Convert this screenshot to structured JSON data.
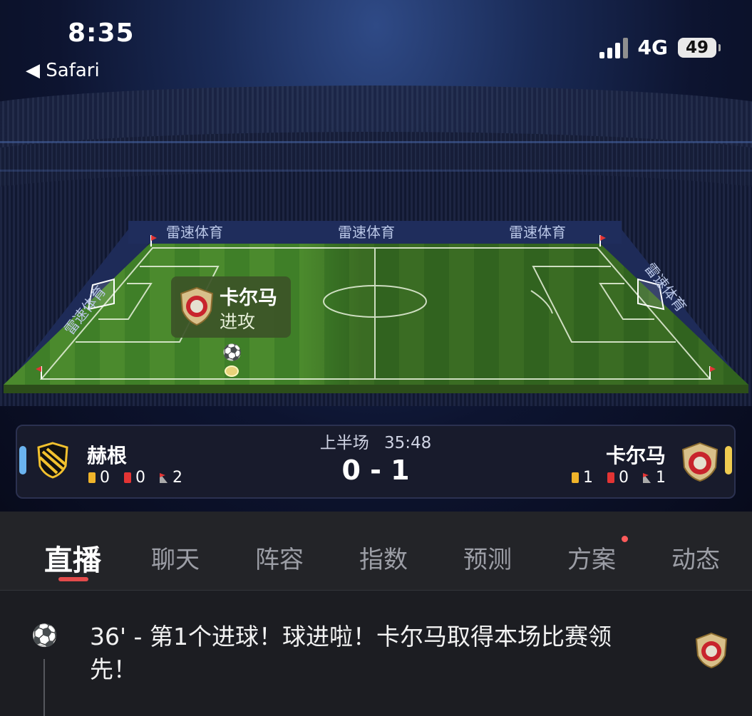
{
  "status": {
    "time": "8:35",
    "back_label": "◀ Safari",
    "network": "4G",
    "battery": "49"
  },
  "brand": {
    "board_text": "雷速体育"
  },
  "attack_popup": {
    "team": "卡尔马",
    "action": "进攻"
  },
  "match": {
    "period": "上半场",
    "clock": "35:48",
    "score": "0 - 1",
    "home": {
      "name": "赫根",
      "yellow": "0",
      "red": "0",
      "corners": "2",
      "color": "#6ab3ef"
    },
    "away": {
      "name": "卡尔马",
      "yellow": "1",
      "red": "0",
      "corners": "1",
      "color": "#f0cc50"
    }
  },
  "tabs": [
    {
      "label": "直播"
    },
    {
      "label": "聊天"
    },
    {
      "label": "阵容"
    },
    {
      "label": "指数"
    },
    {
      "label": "预测"
    },
    {
      "label": "方案"
    },
    {
      "label": "动态"
    }
  ],
  "feed": [
    {
      "text": "36' - 第1个进球！球进啦！卡尔马取得本场比赛领先！",
      "icon": "football-icon"
    }
  ],
  "colors": {
    "accent": "#e34b4b",
    "pitch": "#3f7f28"
  }
}
